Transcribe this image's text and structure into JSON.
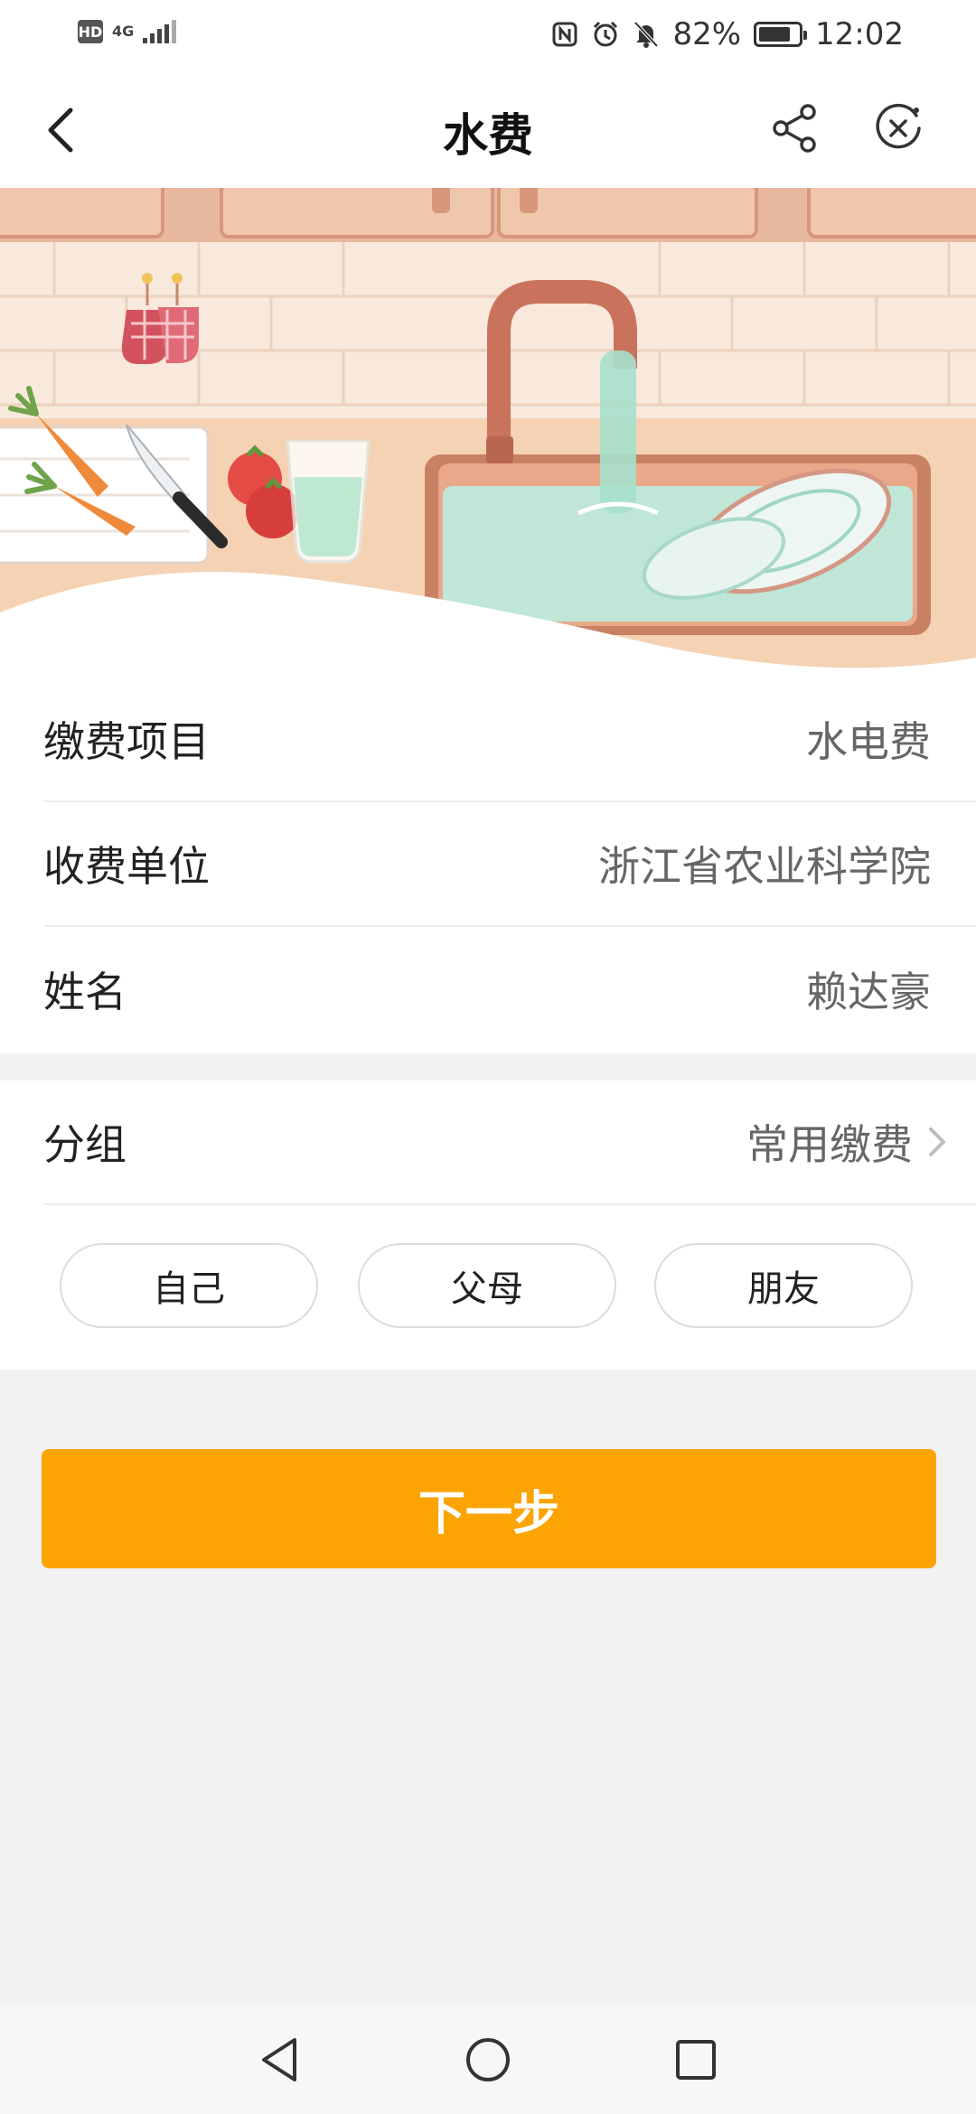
{
  "status_bar": {
    "hd": "HD",
    "network": "4G",
    "battery_percent": "82%",
    "battery_level": 0.82,
    "time": "12:02"
  },
  "nav": {
    "title": "水费",
    "back_icon": "chevron-left-icon",
    "share_icon": "share-icon",
    "close_icon": "close-circle-icon"
  },
  "info": {
    "rows": [
      {
        "label": "缴费项目",
        "value": "水电费"
      },
      {
        "label": "收费单位",
        "value": "浙江省农业科学院"
      },
      {
        "label": "姓名",
        "value": "赖达豪"
      }
    ]
  },
  "group": {
    "label": "分组",
    "value": "常用缴费",
    "options": [
      "自己",
      "父母",
      "朋友"
    ]
  },
  "next_button": "下一步",
  "colors": {
    "accent": "#fba402",
    "background": "#f2f2f2",
    "card": "#ffffff"
  }
}
